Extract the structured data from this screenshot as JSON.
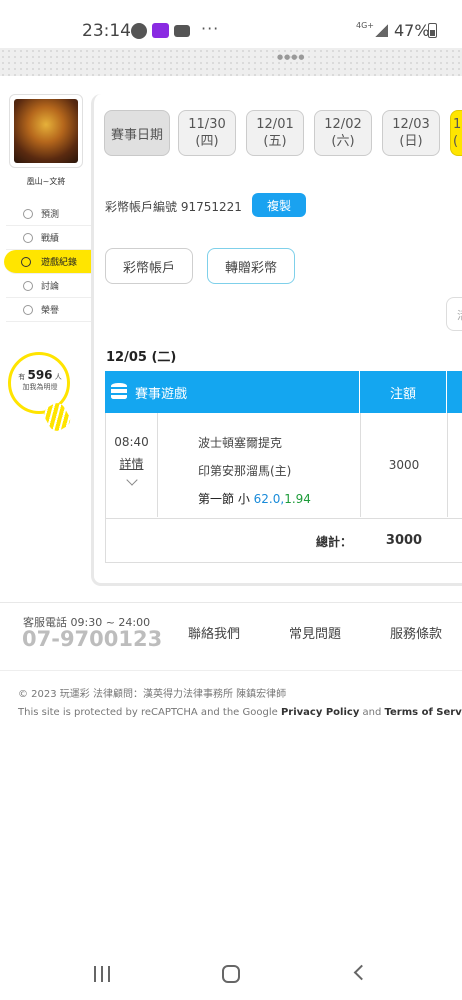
{
  "status_bar": {
    "time": "23:14",
    "dots": "···",
    "network": "4G+",
    "battery": "47%"
  },
  "sidebar": {
    "user_name": "凰山~文將",
    "menu": [
      {
        "label": "預測",
        "icon": "predict-icon",
        "active": false
      },
      {
        "label": "戰績",
        "icon": "record-icon",
        "active": false
      },
      {
        "label": "遊戲紀錄",
        "icon": "game-record-icon",
        "active": true
      },
      {
        "label": "討論",
        "icon": "discuss-icon",
        "active": false
      },
      {
        "label": "榮譽",
        "icon": "honor-icon",
        "active": false
      }
    ],
    "bulb": {
      "prefix": "有",
      "count": "596",
      "suffix": "人",
      "subtitle": "加我為明燈"
    }
  },
  "dates": {
    "label": "賽事日期",
    "chips": [
      {
        "date": "11/30",
        "weekday": "(四)"
      },
      {
        "date": "12/01",
        "weekday": "(五)"
      },
      {
        "date": "12/02",
        "weekday": "(六)"
      },
      {
        "date": "12/03",
        "weekday": "(日)"
      },
      {
        "date": "1",
        "weekday": "("
      }
    ]
  },
  "account": {
    "label": "彩幣帳戶編號 91751221",
    "copy": "複製",
    "btn_account": "彩幣帳戶",
    "btn_transfer": "轉贈彩幣",
    "btn_cut": "活"
  },
  "records": {
    "day": "12/05 (二)",
    "col_game": "賽事遊戲",
    "col_amount": "注額",
    "rows": [
      {
        "time": "08:40",
        "detail": "詳情",
        "team_away": "波士頓塞爾提克",
        "team_home": "印第安那溜馬(主)",
        "bet_prefix": "第一節 小",
        "bet_line": "62.0",
        "bet_sep": ",",
        "bet_odds": "1.94",
        "amount": "3000"
      }
    ],
    "total_label": "總計：",
    "total_value": "3000"
  },
  "footer": {
    "service_label": "客服電話 09:30 ~ 24:00",
    "phone": "07-9700123",
    "links": [
      "聯絡我們",
      "常見問題",
      "服務條款"
    ],
    "copyright": "© 2023 玩運彩 法律顧問：漢英得力法律事務所 陳鎮宏律師",
    "recaptcha_prefix": "This site is protected by reCAPTCHA and the Google ",
    "privacy": "Privacy Policy",
    "and": " and ",
    "terms": "Terms of Service"
  }
}
